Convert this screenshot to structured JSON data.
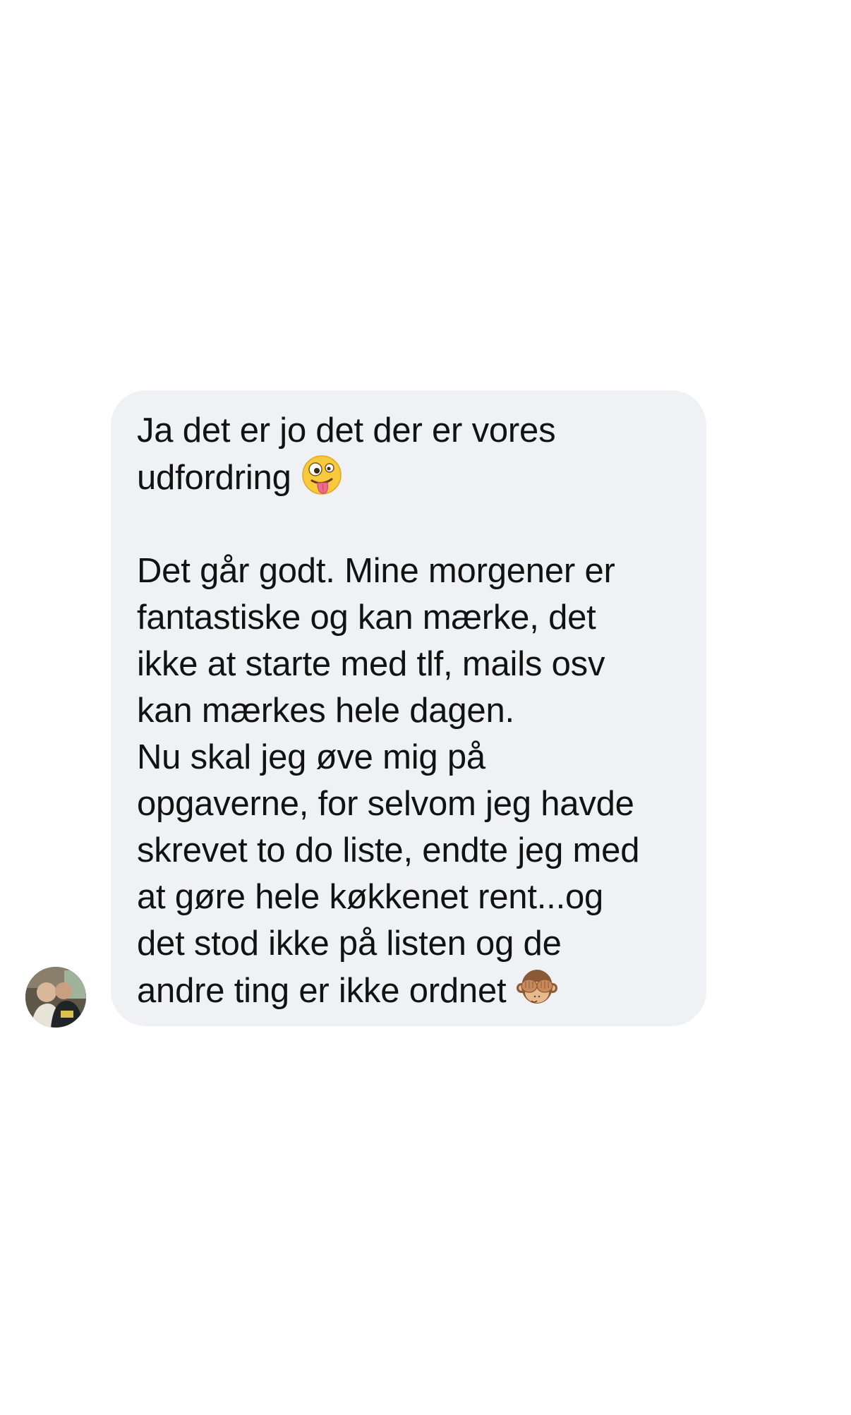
{
  "conversation": {
    "message": {
      "paragraph1": "Ja det er jo det der er vores\nudfordring ",
      "emoji1": "zany-face",
      "paragraph2": "\n\nDet går godt. Mine morgener er\nfantastiske og kan mærke, det\nikke at starte med tlf, mails osv\nkan mærkes hele dagen.\nNu skal jeg øve mig på\nopgaverne, for selvom jeg havde\nskrevet to do liste, endte jeg med\nat gøre hele køkkenet rent...og\ndet stod ikke på listen og de\nandre ting er ikke ordnet ",
      "emoji2": "see-no-evil-monkey"
    },
    "bubble_color": "#f0f1f5",
    "text_color": "#121212"
  }
}
